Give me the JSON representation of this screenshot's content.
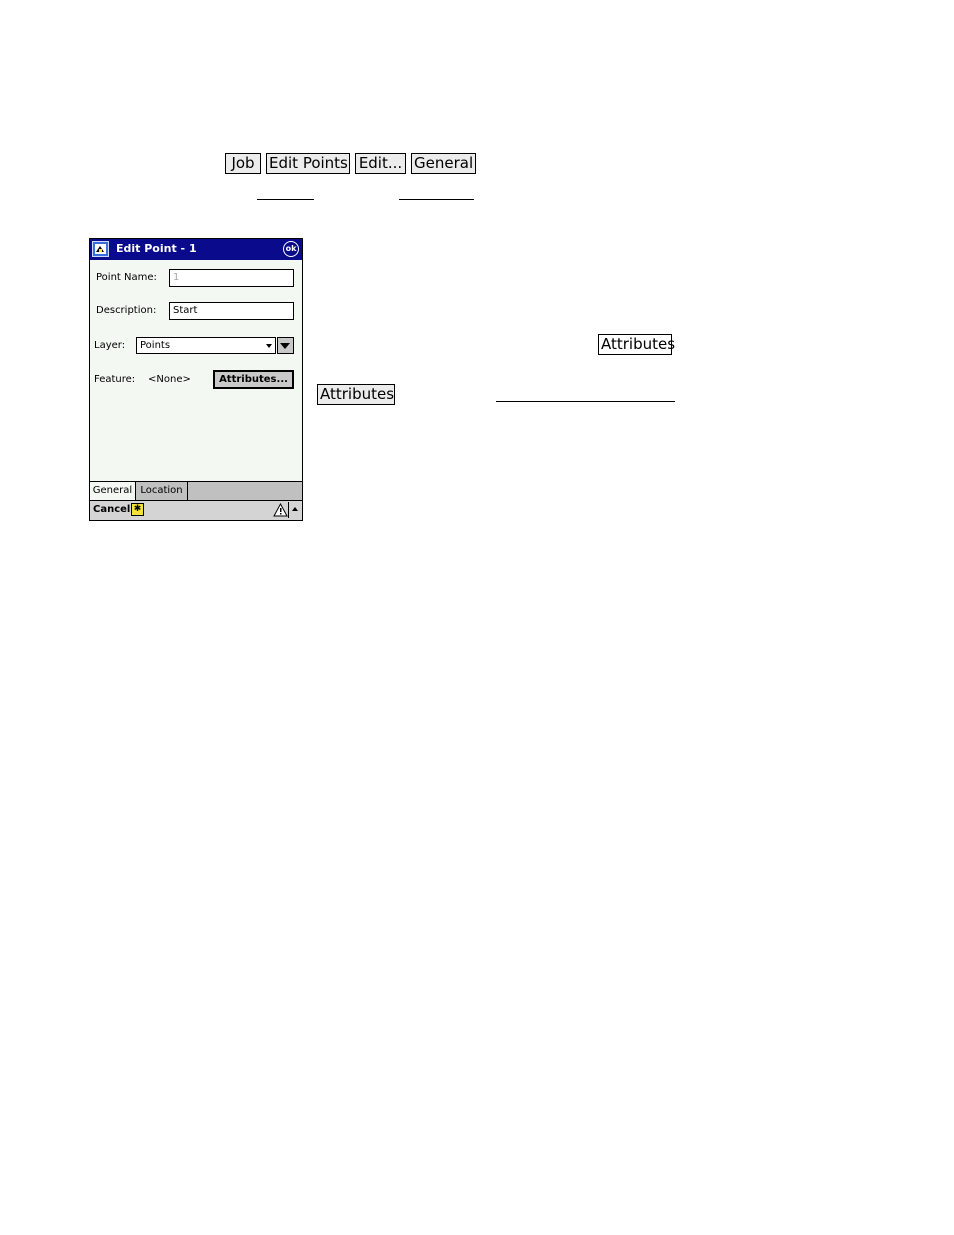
{
  "nav_buttons": [
    "Job",
    "Edit Points",
    "Edit...",
    "General"
  ],
  "pda": {
    "title": "Edit Point - 1",
    "ok_label": "ok",
    "point_name_label": "Point Name:",
    "point_name_value": "1",
    "description_label": "Description:",
    "description_value": "Start",
    "layer_label": "Layer:",
    "layer_value": "Points",
    "feature_label": "Feature:",
    "feature_value": "<None>",
    "attributes_button": "Attributes...",
    "tabs": [
      "General",
      "Location"
    ],
    "cancel_label": "Cancel",
    "star_glyph": "✱"
  },
  "side_buttons": {
    "attributes_1": "Attributes",
    "attributes_2": "Attributes"
  },
  "colors": {
    "titlebar": "#0a0a8c",
    "screen_bg": "#f3f8f3"
  }
}
